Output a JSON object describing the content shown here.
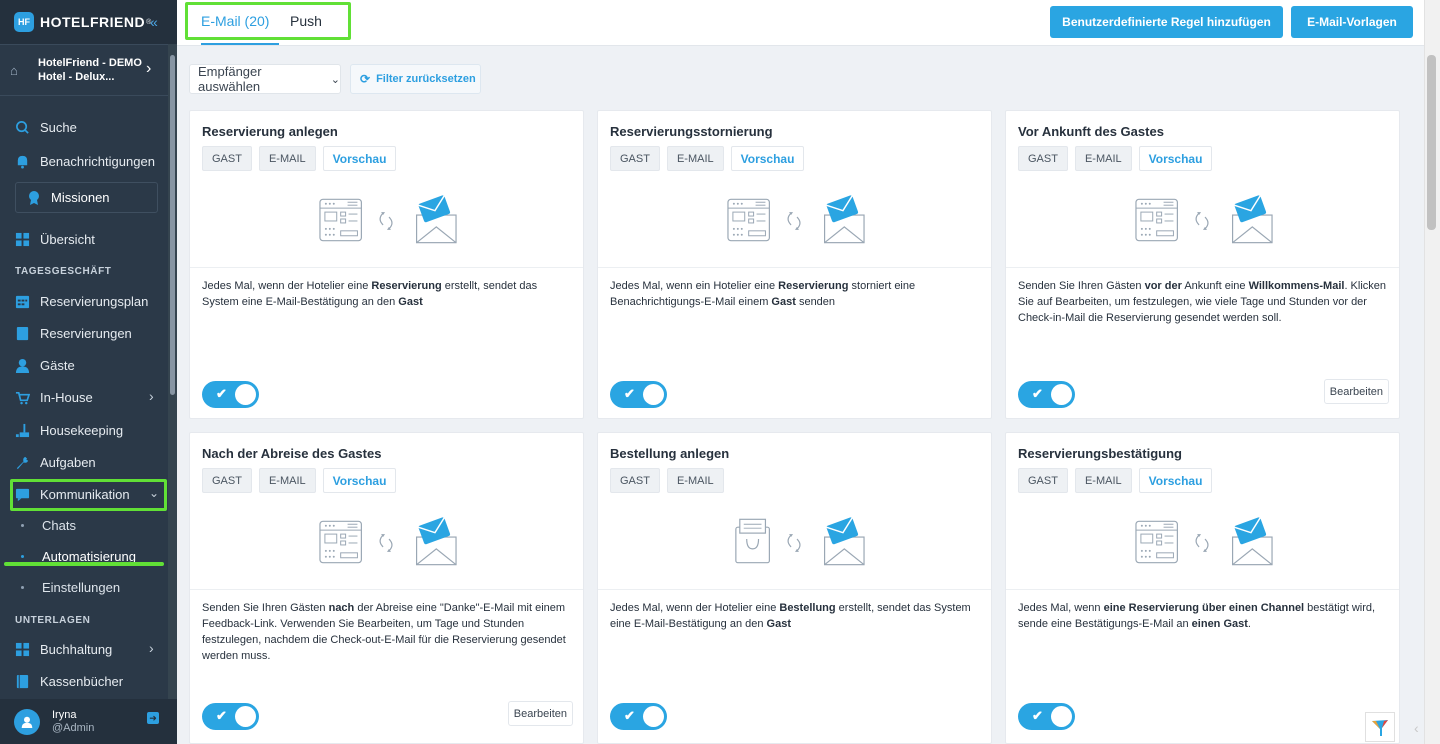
{
  "app": {
    "logo": "HOTELFRIEND",
    "logo_reg": "®",
    "logo_mark": "HF"
  },
  "sidebar": {
    "hotel": "HotelFriend - DEMO Hotel - Delux...",
    "search": "Suche",
    "notifications": "Benachrichtigungen",
    "missions": "Missionen",
    "overview": "Übersicht",
    "section_daily": "TAGESGESCHÄFT",
    "reservation_plan": "Reservierungsplan",
    "reservations": "Reservierungen",
    "guests": "Gäste",
    "inhouse": "In-House",
    "housekeeping": "Housekeeping",
    "tasks": "Aufgaben",
    "communication": "Kommunikation",
    "chats": "Chats",
    "automation": "Automatisierung",
    "settings": "Einstellungen",
    "section_docs": "UNTERLAGEN",
    "accounting": "Buchhaltung",
    "cashbooks": "Kassenbücher",
    "user_name": "Iryna",
    "user_role": "@Admin"
  },
  "tabs": {
    "email": "E-Mail (20)",
    "push": "Push"
  },
  "toolbar": {
    "custom_rule": "Benutzerdefinierte Regel hinzufügen",
    "email_templates": "E-Mail-Vorlagen"
  },
  "filters": {
    "recipients": "Empfänger auswählen",
    "reset": "Filter zurücksetzen"
  },
  "tags": {
    "guest": "GAST",
    "email": "E-MAIL",
    "preview": "Vorschau"
  },
  "edit_label": "Bearbeiten",
  "cards": [
    {
      "title": "Reservierung anlegen",
      "enabled": true
    },
    {
      "title": "Reservierungsstornierung",
      "enabled": true
    },
    {
      "title": "Vor Ankunft des Gastes",
      "enabled": true
    },
    {
      "title": "Nach der Abreise des Gastes",
      "enabled": true
    },
    {
      "title": "Bestellung anlegen",
      "enabled": true
    },
    {
      "title": "Reservierungsbestätigung",
      "enabled": true
    }
  ],
  "desc": {
    "c0": [
      "Jedes Mal, wenn der Hotelier eine ",
      "Reservierung",
      " erstellt, sendet das System eine E-Mail-Bestätigung an den ",
      "Gast"
    ],
    "c1": [
      "Jedes Mal, wenn ein Hotelier eine ",
      "Reservierung",
      " storniert eine Benachrichtigungs-E-Mail einem ",
      "Gast",
      " senden"
    ],
    "c2": [
      "Senden Sie Ihren Gästen ",
      "vor der",
      " Ankunft eine ",
      "Willkommens-Mail",
      ". Klicken Sie auf Bearbeiten, um festzulegen, wie viele Tage und Stunden vor der Check-in-Mail die Reservierung gesendet werden soll."
    ],
    "c3": [
      "Senden Sie Ihren Gästen ",
      "nach",
      " der Abreise eine \"Danke\"-E-Mail mit einem Feedback-Link. Verwenden Sie Bearbeiten, um Tage und Stunden festzulegen, nachdem die Check-out-E-Mail für die Reservierung gesendet werden muss."
    ],
    "c4": [
      "Jedes Mal, wenn der Hotelier eine ",
      "Bestellung",
      " erstellt, sendet das System eine E-Mail-Bestätigung an den ",
      "Gast"
    ],
    "c5": [
      "Jedes Mal, wenn ",
      "eine Reservierung über einen Channel",
      " bestätigt wird, sende eine Bestätigungs-E-Mail an ",
      "einen Gast",
      "."
    ]
  },
  "colors": {
    "accent": "#2aa5e2",
    "sidebar": "#2b3948",
    "highlight": "#61e036"
  }
}
